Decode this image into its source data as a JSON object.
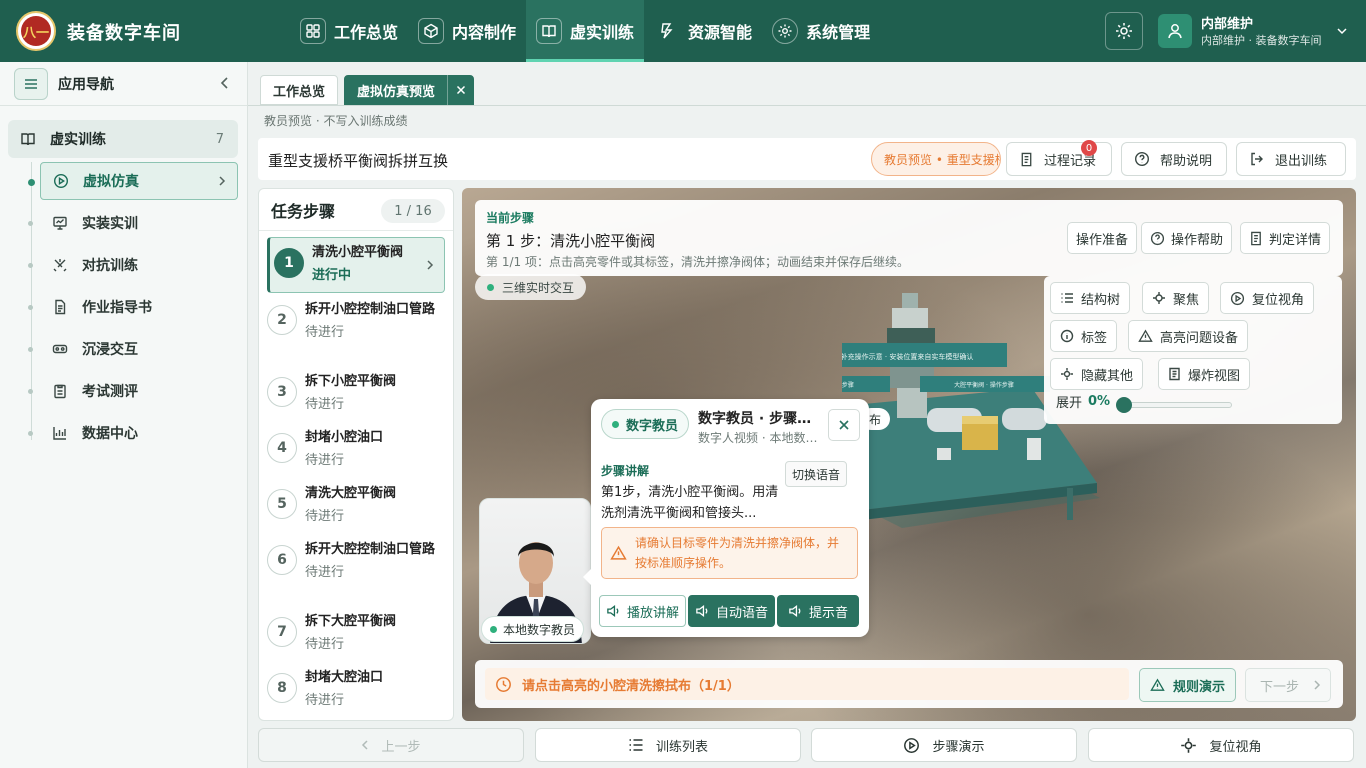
{
  "app": {
    "name": "装备数字车间",
    "logo_text": "八一"
  },
  "nav": [
    {
      "label": "工作总览",
      "icon": "grid-icon"
    },
    {
      "label": "内容制作",
      "icon": "cube-icon"
    },
    {
      "label": "虚实训练",
      "icon": "book-icon",
      "active": true
    },
    {
      "label": "资源智能",
      "icon": "bolt-icon"
    },
    {
      "label": "系统管理",
      "icon": "gear-icon"
    }
  ],
  "user": {
    "name": "内部维护",
    "sub": "内部维护 · 装备数字车间"
  },
  "sidebar": {
    "title": "应用导航",
    "group": {
      "label": "虚实训练",
      "count": "7"
    },
    "items": [
      {
        "label": "虚拟仿真",
        "icon": "play-circle-icon",
        "active": true
      },
      {
        "label": "实装实训",
        "icon": "monitor-icon"
      },
      {
        "label": "对抗训练",
        "icon": "swords-icon"
      },
      {
        "label": "作业指导书",
        "icon": "document-icon"
      },
      {
        "label": "沉浸交互",
        "icon": "vr-headset-icon"
      },
      {
        "label": "考试测评",
        "icon": "clipboard-icon"
      },
      {
        "label": "数据中心",
        "icon": "chart-icon"
      }
    ]
  },
  "tabs": [
    {
      "label": "工作总览"
    },
    {
      "label": "虚拟仿真预览",
      "active": true
    }
  ],
  "breadcrumb": "教员预览 · 不写入训练成绩",
  "page": {
    "title": "重型支援桥平衡阀拆拼互换",
    "mode_tag": "教员预览 • 重型支援桥平衡阀拆拼互换",
    "process_btn": "过程记录",
    "process_badge": "0",
    "help_btn": "帮助说明",
    "exit_btn": "退出训练"
  },
  "steps": {
    "title": "任务步骤",
    "counter": "1 / 16",
    "items": [
      {
        "num": "1",
        "name": "清洗小腔平衡阀",
        "status": "进行中"
      },
      {
        "num": "2",
        "name": "拆开小腔控制油口管路",
        "status": "待进行"
      },
      {
        "num": "3",
        "name": "拆下小腔平衡阀",
        "status": "待进行"
      },
      {
        "num": "4",
        "name": "封堵小腔油口",
        "status": "待进行"
      },
      {
        "num": "5",
        "name": "清洗大腔平衡阀",
        "status": "待进行"
      },
      {
        "num": "6",
        "name": "拆开大腔控制油口管路",
        "status": "待进行"
      },
      {
        "num": "7",
        "name": "拆下大腔平衡阀",
        "status": "待进行"
      },
      {
        "num": "8",
        "name": "封堵大腔油口",
        "status": "待进行"
      }
    ]
  },
  "current": {
    "label": "当前步骤",
    "name": "第 1 步：清洗小腔平衡阀",
    "desc": "第 1/1 项：点击高亮零件或其标签，清洗并擦净阀体；动画结束并保存后继续。",
    "btn_prepare": "操作准备",
    "btn_help": "操作帮助",
    "btn_judge": "判定详情"
  },
  "live": "三维实时交互",
  "tools": {
    "tree": "结构树",
    "focus": "聚焦",
    "reset": "复位视角",
    "label": "标签",
    "highlight": "高亮问题设备",
    "hide": "隐藏其他",
    "explode": "爆炸视图",
    "expand_label": "展开",
    "expand_value": "0%",
    "expand_fraction": 0
  },
  "scene": {
    "banner": "补充操作示意 · 安装位置来自实车模型确认",
    "left_label": "小腔平衡阀 · 操作步骤",
    "right_label": "大腔平衡阀 · 操作步骤",
    "partial_tag": "布"
  },
  "teacher": {
    "badge": "数字教员",
    "title": "数字教员 · 步骤讲解",
    "sub": "数字人视频 · 本地数字教员",
    "section": "步骤讲解",
    "switch": "切换语音",
    "text": "第1步，清洗小腔平衡阀。用清洗剂清洗平衡阀和管接头...",
    "warning": "请确认目标零件为清洗并擦净阀体，并按标准顺序操作。",
    "btn_play": "播放讲解",
    "btn_auto": "自动语音",
    "btn_tone": "提示音",
    "local": "本地数字教员"
  },
  "hint": {
    "text": "请点击高亮的小腔清洗擦拭布（1/1）",
    "rule": "规则演示",
    "next": "下一步"
  },
  "bottom": {
    "prev": "上一步",
    "list": "训练列表",
    "demo": "步骤演示",
    "reset": "复位视角"
  }
}
